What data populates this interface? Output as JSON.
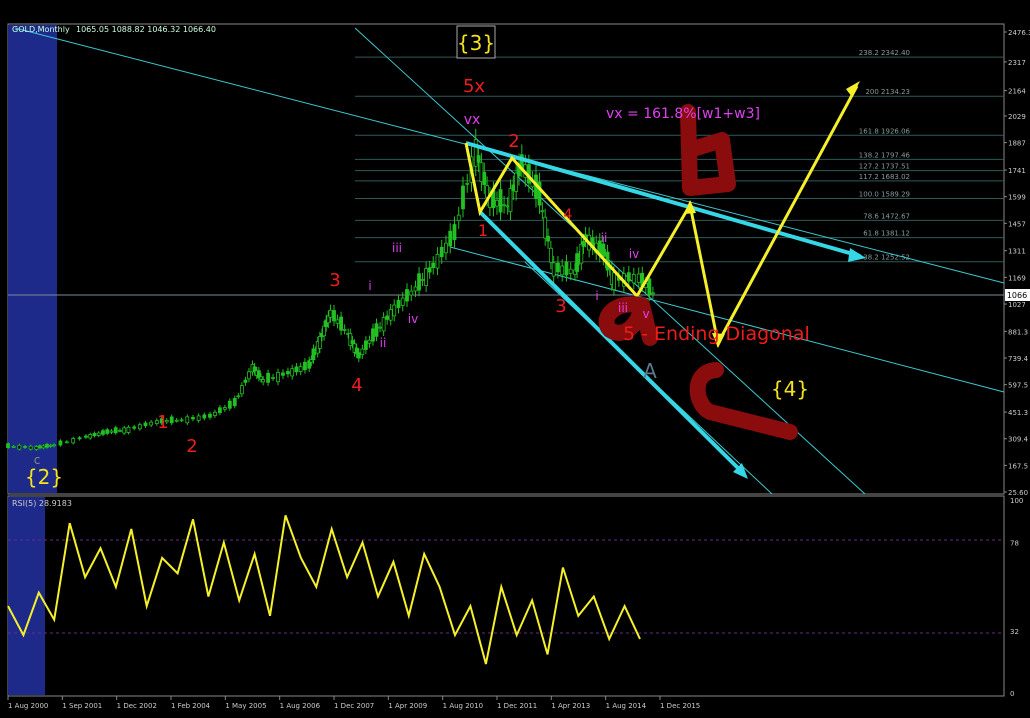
{
  "header": {
    "symbol": "GOLD,Monthly",
    "ohlc": "1065.05 1088.82 1046.32 1066.40"
  },
  "colors": {
    "background": "#000000",
    "candle": "#22c022",
    "channel_line": "#3cc8d0",
    "arrow_cyan": "#35d7e6",
    "arrow_yellow": "#f5f02a",
    "label_red": "#ee1c1c",
    "label_magenta": "#e040f0",
    "label_yellow": "#f5e31e",
    "fib_line": "#2f5a5a",
    "rsi_line": "#f5f02a",
    "highlight_band": "#1d2a8a"
  },
  "price_axis": {
    "ticks": [
      "2476.3",
      "2317",
      "2164",
      "2029",
      "1887",
      "1741",
      "1599",
      "1457",
      "1311",
      "1169",
      "1027",
      "881.3",
      "739.4",
      "597.5",
      "451.3",
      "309.4",
      "167.5",
      "25.60"
    ],
    "current_price": "1066"
  },
  "x_axis": {
    "ticks": [
      "1 Aug 2000",
      "1 Sep 2001",
      "1 Dec 2002",
      "1 Feb 2004",
      "1 May 2005",
      "1 Aug 2006",
      "1 Dec 2007",
      "1 Apr 2009",
      "1 Aug 2010",
      "1 Dec 2011",
      "1 Apr 2013",
      "1 Aug 2014",
      "1 Dec 2015"
    ]
  },
  "fib_levels": [
    {
      "ratio": "238.2",
      "price": "2342.40",
      "label": "238.2 2342.40"
    },
    {
      "ratio": "200",
      "price": "2134.23",
      "label": "200 2134.23"
    },
    {
      "ratio": "161.8",
      "price": "1926.06",
      "label": "161.8 1926.06"
    },
    {
      "ratio": "138.2",
      "price": "1797.46",
      "label": "138.2 1797.46"
    },
    {
      "ratio": "127.2",
      "price": "1737.51",
      "label": "127.2 1737.51"
    },
    {
      "ratio": "117.2",
      "price": "1683.02",
      "label": "117.2 1683.02"
    },
    {
      "ratio": "100.0",
      "price": "1589.29",
      "label": "100.0 1589.29"
    },
    {
      "ratio": "78.6",
      "price": "1472.67",
      "label": "78.6 1472.67"
    },
    {
      "ratio": "61.8",
      "price": "1381.12",
      "label": "61.8 1381.12"
    },
    {
      "ratio": "38.2",
      "price": "1252.52",
      "label": "38.2 1252.52"
    }
  ],
  "annotations": {
    "wave3_box": "{3}",
    "wave2_box": "{2}",
    "wave4_box": "{4}",
    "label_5x": "5x",
    "label_vx": "vx",
    "formula": "vx = 161.8%[w1+w3]",
    "ending_diagonal": "5 - Ending Diagonal",
    "label_A": "A",
    "label_c": "c",
    "wave_1_early": "1",
    "wave_2_early": "2",
    "wave_3_mid": "3",
    "wave_4_mid": "4",
    "wave_i_mid": "i",
    "wave_ii_mid": "ii",
    "wave_iii_mid": "iii",
    "wave_iv_mid": "iv",
    "wave_1_top": "1",
    "wave_2_top": "2",
    "wave_3_down": "3",
    "wave_4_down": "4",
    "sub_i": "i",
    "sub_ii": "ii",
    "sub_iii": "iii",
    "sub_iv": "iv",
    "sub_v": "v",
    "letter_b": "b",
    "letter_a": "a",
    "letter_c": "c"
  },
  "rsi": {
    "label": "RSI(5) 28.9183",
    "levels": [
      "100",
      "78",
      "32",
      "0"
    ]
  },
  "chart_data": {
    "type": "line",
    "title": "GOLD,Monthly",
    "x_range": [
      "Aug 2000",
      "Dec 2015"
    ],
    "series": [
      {
        "name": "GOLD,Monthly",
        "x": [
          "2000-08",
          "2001-04",
          "2001-09",
          "2002-06",
          "2002-12",
          "2003-06",
          "2004-02",
          "2004-09",
          "2005-05",
          "2005-12",
          "2006-05",
          "2006-08",
          "2007-03",
          "2007-09",
          "2007-12",
          "2008-03",
          "2008-08",
          "2008-11",
          "2009-04",
          "2009-09",
          "2010-03",
          "2010-08",
          "2011-02",
          "2011-08",
          "2011-12",
          "2012-05",
          "2012-09",
          "2013-02",
          "2013-06",
          "2013-12",
          "2014-03",
          "2014-08",
          "2014-11",
          "2015-06",
          "2015-11"
        ],
        "values": [
          270,
          262,
          275,
          320,
          345,
          360,
          400,
          410,
          430,
          500,
          690,
          620,
          660,
          700,
          830,
          980,
          870,
          750,
          880,
          1000,
          1110,
          1230,
          1400,
          1850,
          1580,
          1550,
          1780,
          1600,
          1220,
          1200,
          1380,
          1300,
          1160,
          1170,
          1066
        ]
      }
    ],
    "rsi_series": {
      "name": "RSI(5) 28.9183",
      "ylim": [
        0,
        100
      ],
      "levels": [
        78,
        32
      ],
      "values": [
        45,
        30,
        52,
        38,
        88,
        60,
        75,
        55,
        85,
        45,
        70,
        62,
        90,
        50,
        78,
        48,
        72,
        40,
        92,
        70,
        55,
        85,
        60,
        78,
        50,
        68,
        40,
        72,
        55,
        30,
        45,
        15,
        55,
        30,
        48,
        20,
        65,
        40,
        50,
        28,
        45,
        28
      ]
    },
    "ylim": [
      25.6,
      2476.3
    ]
  }
}
